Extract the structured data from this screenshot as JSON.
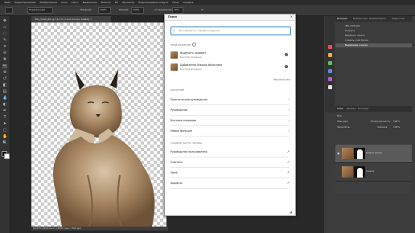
{
  "menubar": [
    "Файл",
    "Редактирование",
    "Изображение",
    "Слои",
    "Текст",
    "Выделение",
    "Фильтр",
    "3D",
    "Просмотр",
    "Подключаемые модули",
    "Окно",
    "Справка"
  ],
  "options": {
    "mode": "Нормальный",
    "opacity_label": "Непрозр.:",
    "opacity": "100%",
    "flow_label": "Нажим:",
    "flow": "100%",
    "smooth_label": "Сглаживание:",
    "smooth": "10%",
    "angle": "0°"
  },
  "document": {
    "tab_title": "IMG_5945.JPG @ 16,7% (Слой Копия, RGB/8) *",
    "status": "16,67% 3000 пикс. x 4500 пикс. (300 ppi)"
  },
  "dialog": {
    "title": "Поиск",
    "search_placeholder": "Инструменты, справка и другое",
    "suggestions_header": "ПРЕДЛОЖЕНИЯ",
    "suggestions": [
      {
        "title": "Выделить предмет",
        "sub": "Быстрая операция"
      },
      {
        "title": "Добавление бликов объектива",
        "sub": "Быстрая операция"
      }
    ],
    "more_label": "Обучение мне",
    "learn_header": "ОБУЧЕНИЕ",
    "learn_rows": [
      "Практические руководства",
      "Руководства",
      "Быстрые операции",
      "Новые функции"
    ],
    "links_header": "ССЫЛКИ ЧАСТО ПОСЕЩ.",
    "link_rows": [
      "Руководство пользователя",
      "Плагины",
      "Stock",
      "Шрифты"
    ]
  },
  "panels": {
    "top_tabs": [
      "История",
      "Библиотеки",
      "Комментарии",
      "Навигатор"
    ],
    "history_file": "IMG_5945.JPG",
    "history_items": [
      "Открыть",
      "Выделить объект",
      "Создать слой Копия",
      "Выделение и маска"
    ],
    "layer_tabs": [
      "Слои",
      "Каналы",
      "Контуры"
    ],
    "layer_kind": "Вид",
    "blend_mode": "Обычные",
    "opacity_label": "Непрозрачность:",
    "opacity": "100%",
    "lock_label": "Закрепить:",
    "fill_label": "Заливка:",
    "fill": "100%",
    "layers": [
      {
        "name": "Слой 0 копия"
      },
      {
        "name": "Слой 0"
      }
    ]
  },
  "colors": {
    "accent": "#2e7dd1",
    "swatches": [
      "#e84f5c",
      "#f3aa42",
      "#5bc05b",
      "#5a8de0",
      "#b25bd6",
      "#e0e0e0"
    ]
  }
}
